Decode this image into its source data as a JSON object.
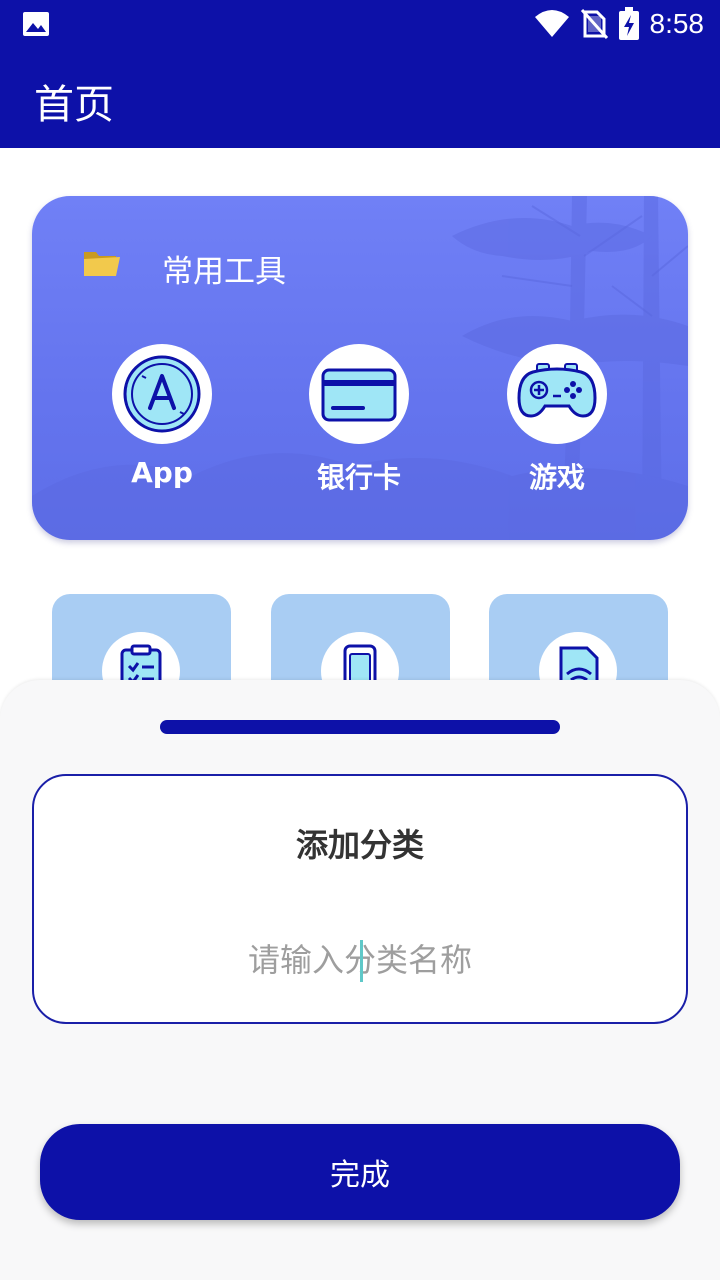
{
  "status_bar": {
    "time": "8:58",
    "icons": [
      "image-icon",
      "wifi-icon",
      "no-sim-icon",
      "battery-charging-icon"
    ]
  },
  "app_bar": {
    "title": "首页"
  },
  "tools_card": {
    "title": "常用工具",
    "icon": "folder-icon",
    "items": [
      {
        "label": "App",
        "icon": "app-store-icon"
      },
      {
        "label": "银行卡",
        "icon": "bank-card-icon"
      },
      {
        "label": "游戏",
        "icon": "gamepad-icon"
      }
    ]
  },
  "shortcuts": [
    {
      "icon": "clipboard-list-icon"
    },
    {
      "icon": "phone-icon"
    },
    {
      "icon": "wifi-sim-icon"
    }
  ],
  "sheet": {
    "dialog_title": "添加分类",
    "input_placeholder": "请输入分类名称",
    "input_value": "",
    "done_label": "完成"
  },
  "colors": {
    "primary": "#0d11a8",
    "card_gradient_top": "#7080f6",
    "card_gradient_bottom": "#5d6ee8",
    "shortcut_bg": "#a9cdf3",
    "icon_fill": "#9fe6f6"
  }
}
